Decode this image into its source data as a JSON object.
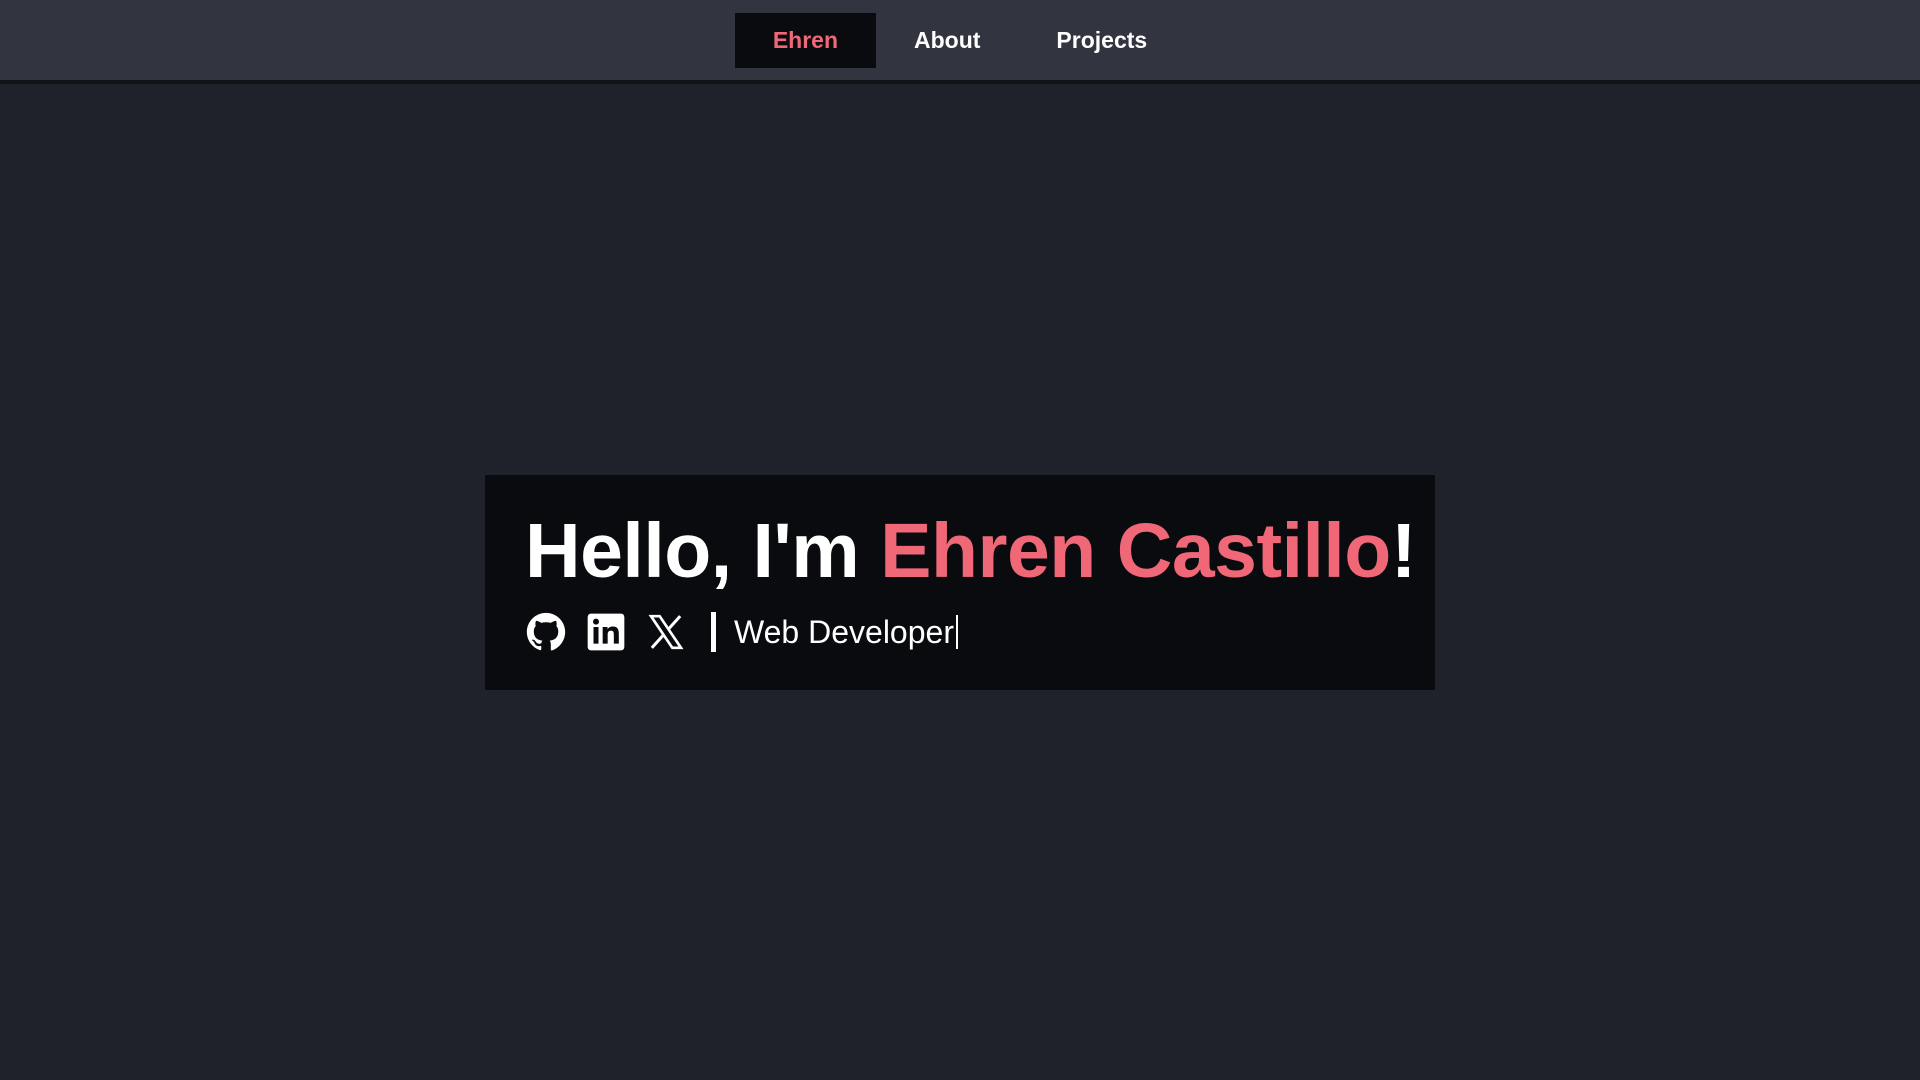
{
  "nav": {
    "items": [
      {
        "label": "Ehren",
        "active": true
      },
      {
        "label": "About",
        "active": false
      },
      {
        "label": "Projects",
        "active": false
      }
    ]
  },
  "hero": {
    "greeting": "Hello, I'm ",
    "name": "Ehren Castillo",
    "punct": "!",
    "role": "Web Developer",
    "social": [
      "github-icon",
      "linkedin-icon",
      "x-icon"
    ]
  },
  "colors": {
    "accent": "#f06878",
    "background": "#1f222b",
    "topbar": "#32353f",
    "panel": "#0a0b0f"
  }
}
